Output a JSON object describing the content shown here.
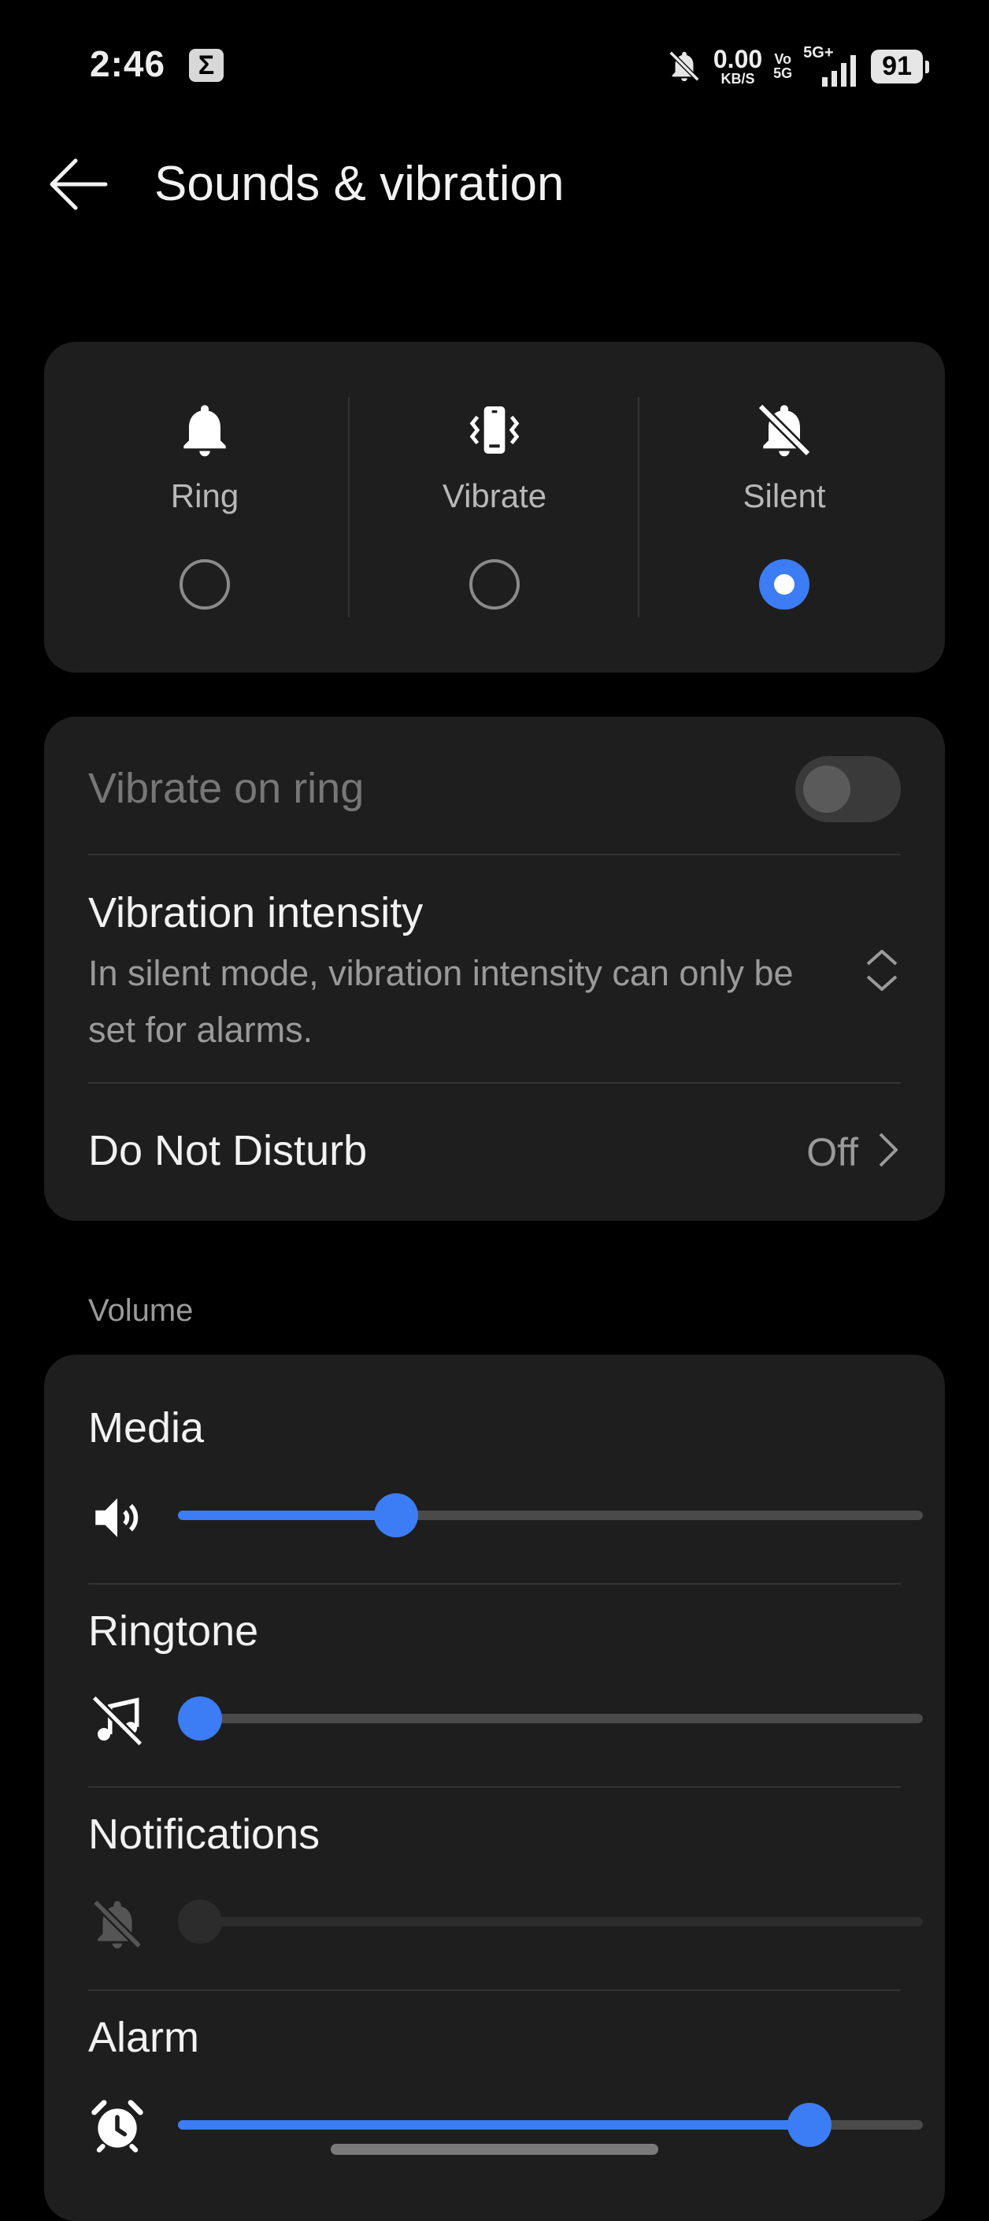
{
  "status_bar": {
    "time": "2:46",
    "sigma": "Σ",
    "speed_value": "0.00",
    "speed_unit": "KB/S",
    "volte_top": "Vo",
    "volte_bottom": "5G",
    "network": "5G+",
    "battery": "91"
  },
  "header": {
    "title": "Sounds & vibration"
  },
  "sound_modes": {
    "selected": "Silent",
    "items": [
      {
        "label": "Ring",
        "icon": "bell-icon",
        "selected": false
      },
      {
        "label": "Vibrate",
        "icon": "vibrate-icon",
        "selected": false
      },
      {
        "label": "Silent",
        "icon": "bell-off-icon",
        "selected": true
      }
    ]
  },
  "settings": {
    "vibrate_on_ring": {
      "label": "Vibrate on ring",
      "enabled": false,
      "on": false
    },
    "vibration_intensity": {
      "label": "Vibration intensity",
      "subtitle_line1": "In silent mode, vibration intensity can only be",
      "subtitle_line2": "set for alarms."
    },
    "do_not_disturb": {
      "label": "Do Not Disturb",
      "value": "Off"
    }
  },
  "volume": {
    "section_label": "Volume",
    "items": [
      {
        "label": "Media",
        "icon": "speaker-icon",
        "level": 0.28,
        "enabled": true
      },
      {
        "label": "Ringtone",
        "icon": "music-off-icon",
        "level": 0.0,
        "enabled": true
      },
      {
        "label": "Notifications",
        "icon": "bell-off-icon",
        "level": 0.0,
        "enabled": false
      },
      {
        "label": "Alarm",
        "icon": "alarm-clock-icon",
        "level": 0.87,
        "enabled": true
      }
    ]
  },
  "colors": {
    "accent": "#3c7cf4",
    "card": "#1e1e1e",
    "background": "#000000"
  }
}
